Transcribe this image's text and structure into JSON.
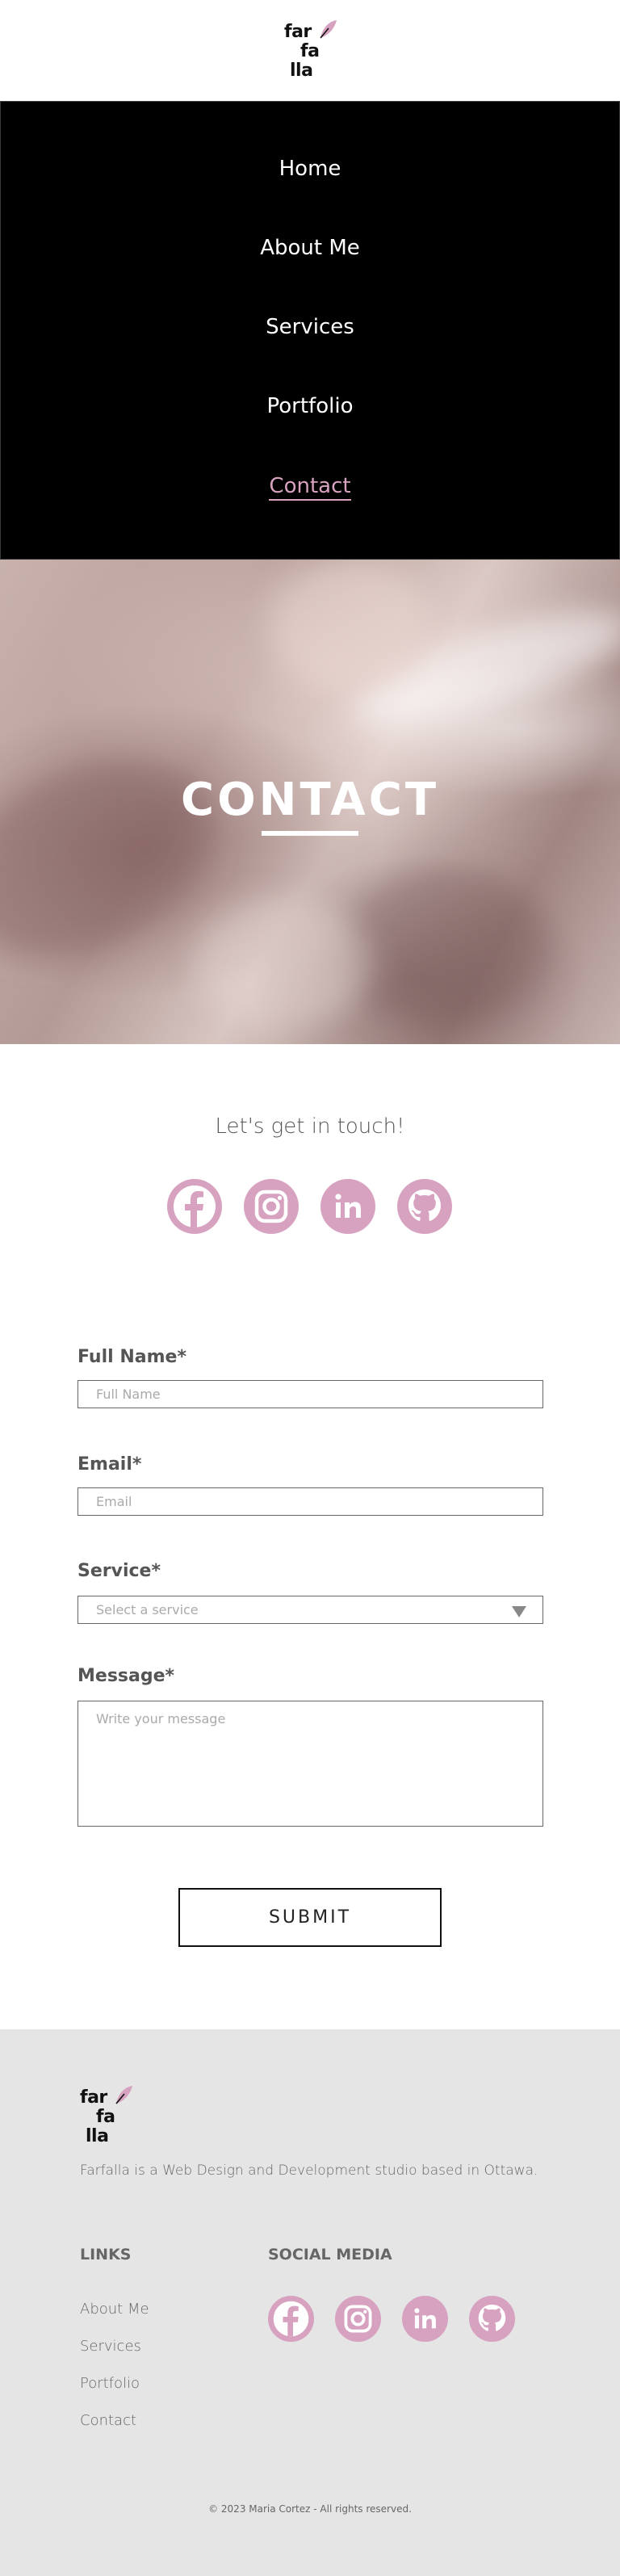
{
  "logo": {
    "line1": "far",
    "line2": "fa",
    "line3": "lla"
  },
  "nav": {
    "items": [
      {
        "label": "Home"
      },
      {
        "label": "About Me"
      },
      {
        "label": "Services"
      },
      {
        "label": "Portfolio"
      },
      {
        "label": "Contact"
      }
    ],
    "active": "Contact"
  },
  "hero": {
    "title": "CONTACT"
  },
  "touch": {
    "heading": "Let's get in touch!"
  },
  "social_icons": [
    "facebook-icon",
    "instagram-icon",
    "linkedin-icon",
    "github-icon"
  ],
  "form": {
    "full_name_label": "Full Name*",
    "full_name_placeholder": "Full Name",
    "email_label": "Email*",
    "email_placeholder": "Email",
    "service_label": "Service*",
    "service_placeholder": "Select a service",
    "message_label": "Message*",
    "message_placeholder": "Write your message",
    "submit_label": "SUBMIT"
  },
  "footer": {
    "description": "Farfalla is a Web Design and Development studio based in Ottawa.",
    "links_heading": "LINKS",
    "links": [
      "About Me",
      "Services",
      "Portfolio",
      "Contact"
    ],
    "social_heading": "SOCIAL MEDIA",
    "copyright": "© 2023 Maria Cortez - All rights reserved."
  },
  "colors": {
    "accent": "#d7a2c0",
    "nav_bg": "#000000",
    "footer_bg": "#e5e5e5",
    "text": "#555555"
  }
}
